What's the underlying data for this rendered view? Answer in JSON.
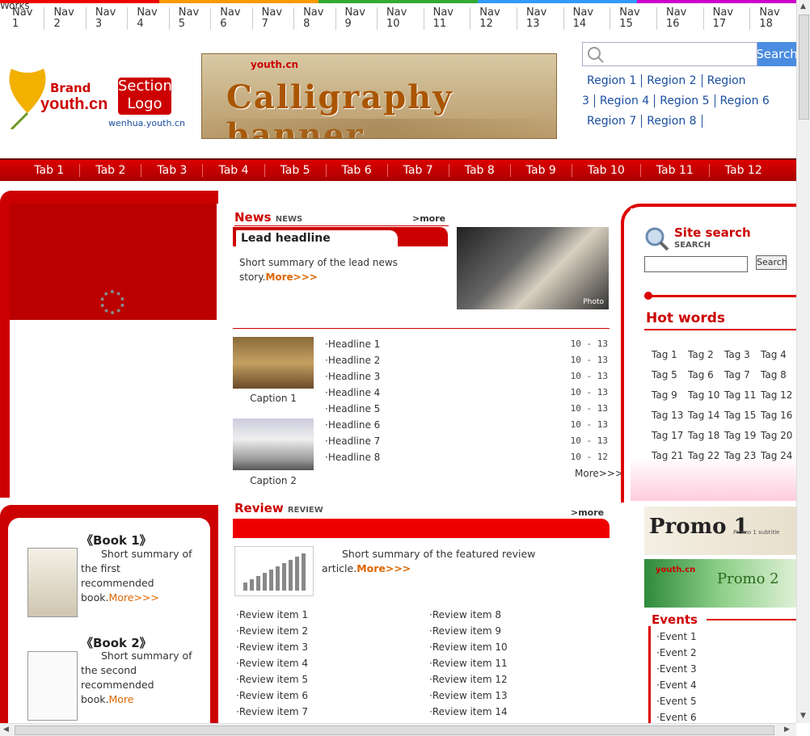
{
  "top_nav": [
    "Nav 1",
    "Nav 2",
    "Nav 3",
    "Nav 4",
    "Nav 5",
    "Nav 6",
    "Nav 7",
    "Nav 8",
    "Nav 9",
    "Nav 10",
    "Nav 11",
    "Nav 12",
    "Nav 13",
    "Nav 14",
    "Nav 15",
    "Nav 16",
    "Nav 17",
    "Nav 18"
  ],
  "logo": {
    "brand_cn": "Brand",
    "brand_en": "youth.cn",
    "sub1": "Section",
    "sub2": "Logo",
    "url": "wenhua.youth.cn"
  },
  "banner": {
    "small_logo": "youth.cn",
    "title": "Calligraphy banner"
  },
  "search_top": {
    "button": "Search",
    "placeholder": ""
  },
  "regions": [
    "Region 1",
    "Region 2",
    "Region 3",
    "Region 4",
    "Region 5",
    "Region 6",
    "Region 7",
    "Region 8"
  ],
  "main_nav": [
    "Tab 1",
    "Tab 2",
    "Tab 3",
    "Tab 4",
    "Tab 5",
    "Tab 6",
    "Tab 7",
    "Tab 8",
    "Tab 9",
    "Tab 10",
    "Tab 11",
    "Tab 12"
  ],
  "works": {
    "title": "Works",
    "books": [
      {
        "title": "《Book 1》",
        "desc": "Short summary of the first recommended book.",
        "more": "More>>>"
      },
      {
        "title": "《Book 2》",
        "desc": "Short summary of the second recommended book.",
        "more": "More"
      }
    ]
  },
  "news_focus": {
    "title_cn": "News",
    "title_en": "NEWS",
    "more": ">more",
    "headline": "Lead headline",
    "summary": "Short summary of the lead news story.",
    "detail": "More>>>",
    "photo_mark": "Photo"
  },
  "news_items": [
    {
      "title": "·Headline 1",
      "date": "10 - 13"
    },
    {
      "title": "·Headline 2",
      "date": "10 - 13"
    },
    {
      "title": "·Headline 3",
      "date": "10 - 13"
    },
    {
      "title": "·Headline 4",
      "date": "10 - 13"
    },
    {
      "title": "·Headline 5",
      "date": "10 - 13"
    },
    {
      "title": "·Headline 6",
      "date": "10 - 13"
    },
    {
      "title": "·Headline 7",
      "date": "10 - 13"
    },
    {
      "title": "·Headline 8",
      "date": "10 - 12"
    }
  ],
  "news_captions": [
    "Caption 1",
    "Caption 2"
  ],
  "news_more": "More>>>",
  "review": {
    "title_cn": "Review",
    "title_en": "REVIEW",
    "more": ">more",
    "summary": "Short summary of the featured review article.",
    "detail": "More>>>"
  },
  "review_left": [
    "·Review item 1",
    "·Review item 2",
    "·Review item 3",
    "·Review item 4",
    "·Review item 5",
    "·Review item 6",
    "·Review item 7"
  ],
  "review_right": [
    "·Review item 8",
    "·Review item 9",
    "·Review item 10",
    "·Review item 11",
    "·Review item 12",
    "·Review item 13",
    "·Review item 14"
  ],
  "side_search": {
    "title_cn": "Site search",
    "title_en": "SEARCH",
    "button": "Search"
  },
  "hot_words": {
    "title": "Hot words",
    "rows": [
      [
        "Tag 1",
        "Tag 2",
        "Tag 3",
        "Tag 4"
      ],
      [
        "Tag 5",
        "Tag 6",
        "Tag 7",
        "Tag 8"
      ],
      [
        "Tag 9",
        "Tag 10",
        "Tag 11",
        "Tag 12"
      ],
      [
        "Tag 13",
        "Tag 14",
        "Tag 15",
        "Tag 16"
      ],
      [
        "Tag 17",
        "Tag 18",
        "Tag 19",
        "Tag 20"
      ],
      [
        "Tag 21",
        "Tag 22",
        "Tag 23",
        "Tag 24"
      ]
    ]
  },
  "ads": [
    {
      "text": "Promo 1",
      "sub": "Promo 1 subtitle"
    },
    {
      "text": "Promo 2",
      "logo": "youth.cn"
    }
  ],
  "activities": {
    "title": "Events",
    "items": [
      "·Event 1",
      "·Event 2",
      "·Event 3",
      "·Event 4",
      "·Event 5",
      "·Event 6"
    ]
  }
}
